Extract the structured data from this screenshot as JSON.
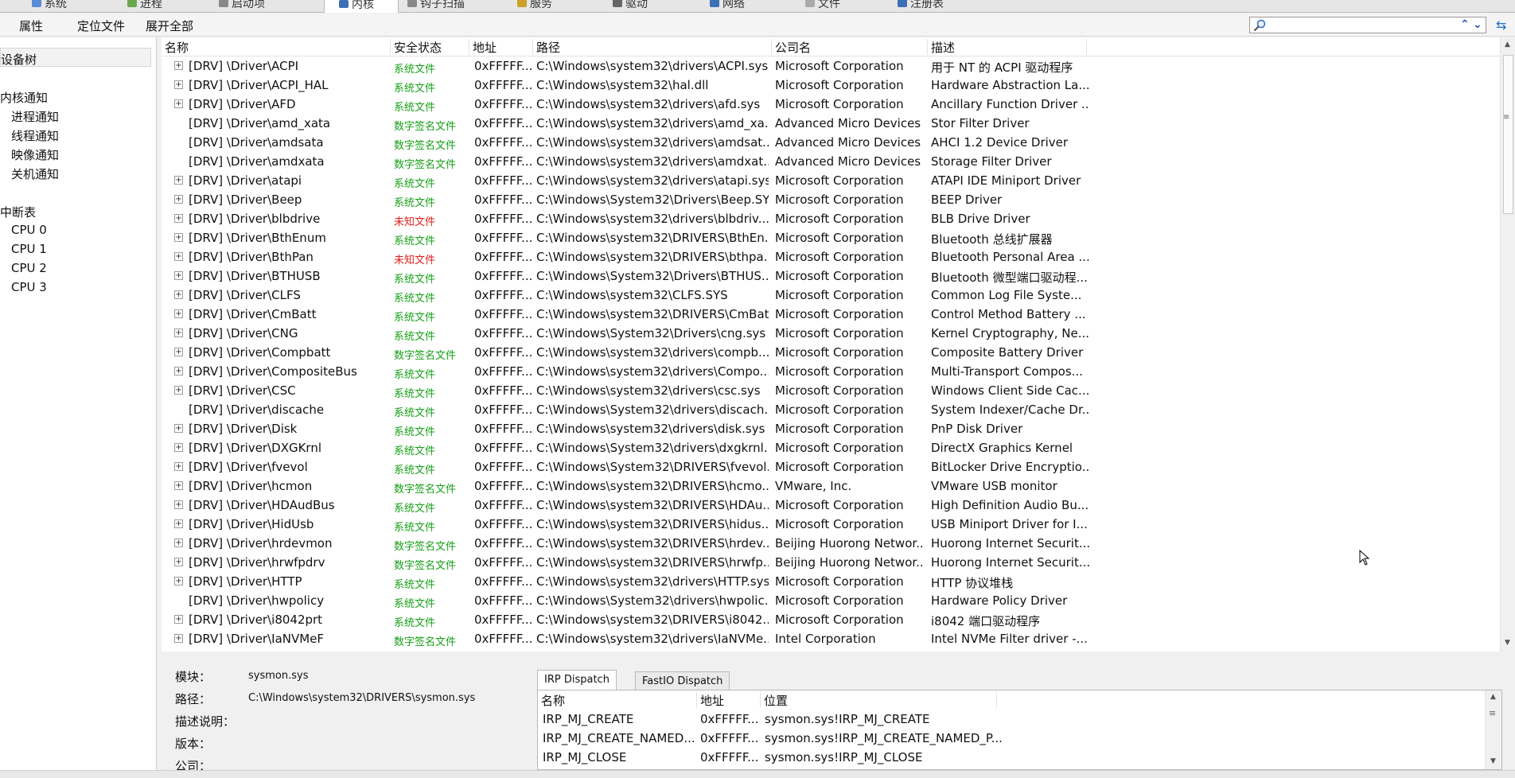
{
  "tabs": [
    {
      "label": "系统",
      "icon": "system-icon",
      "active": false
    },
    {
      "label": "进程",
      "icon": "process-icon",
      "active": false
    },
    {
      "label": "启动项",
      "icon": "startup-icon",
      "active": false
    },
    {
      "label": "内核",
      "icon": "kernel-icon",
      "active": true
    },
    {
      "label": "钩子扫描",
      "icon": "hook-icon",
      "active": false
    },
    {
      "label": "服务",
      "icon": "service-icon",
      "active": false
    },
    {
      "label": "驱动",
      "icon": "driver-icon",
      "active": false
    },
    {
      "label": "网络",
      "icon": "network-icon",
      "active": false
    },
    {
      "label": "文件",
      "icon": "file-icon",
      "active": false
    },
    {
      "label": "注册表",
      "icon": "registry-icon",
      "active": false
    }
  ],
  "toolbar": {
    "properties": "属性",
    "locate_file": "定位文件",
    "expand_all": "展开全部",
    "search_value": ""
  },
  "tree": {
    "header": "设备树",
    "kernel_notify": "内核通知",
    "process_notify": "进程通知",
    "thread_notify": "线程通知",
    "image_notify": "映像通知",
    "shutdown_notify": "关机通知",
    "interrupt_table": "中断表",
    "cpus": [
      "CPU 0",
      "CPU 1",
      "CPU 2",
      "CPU 3"
    ]
  },
  "columns": {
    "name": "名称",
    "security": "安全状态",
    "address": "地址",
    "path": "路径",
    "company": "公司名",
    "description": "描述"
  },
  "rows": [
    {
      "exp": true,
      "name": "[DRV] \\Driver\\ACPI",
      "status": "系统文件",
      "status_kind": "sys",
      "addr": "0xFFFFF...",
      "path": "C:\\Windows\\system32\\drivers\\ACPI.sys",
      "company": "Microsoft Corporation",
      "desc": "用于 NT 的 ACPI 驱动程序"
    },
    {
      "exp": true,
      "name": "[DRV] \\Driver\\ACPI_HAL",
      "status": "系统文件",
      "status_kind": "sys",
      "addr": "0xFFFFF...",
      "path": "C:\\Windows\\system32\\hal.dll",
      "company": "Microsoft Corporation",
      "desc": "Hardware Abstraction La..."
    },
    {
      "exp": true,
      "name": "[DRV] \\Driver\\AFD",
      "status": "系统文件",
      "status_kind": "sys",
      "addr": "0xFFFFF...",
      "path": "C:\\Windows\\system32\\drivers\\afd.sys",
      "company": "Microsoft Corporation",
      "desc": "Ancillary Function Driver ..."
    },
    {
      "exp": false,
      "name": "[DRV] \\Driver\\amd_xata",
      "status": "数字签名文件",
      "status_kind": "signed",
      "addr": "0xFFFFF...",
      "path": "C:\\Windows\\system32\\drivers\\amd_xa...",
      "company": "Advanced Micro Devices",
      "desc": "Stor Filter Driver"
    },
    {
      "exp": false,
      "name": "[DRV] \\Driver\\amdsata",
      "status": "数字签名文件",
      "status_kind": "signed",
      "addr": "0xFFFFF...",
      "path": "C:\\Windows\\system32\\drivers\\amdsat...",
      "company": "Advanced Micro Devices",
      "desc": "AHCI 1.2 Device Driver"
    },
    {
      "exp": false,
      "name": "[DRV] \\Driver\\amdxata",
      "status": "数字签名文件",
      "status_kind": "signed",
      "addr": "0xFFFFF...",
      "path": "C:\\Windows\\system32\\drivers\\amdxat...",
      "company": "Advanced Micro Devices",
      "desc": "Storage Filter Driver"
    },
    {
      "exp": true,
      "name": "[DRV] \\Driver\\atapi",
      "status": "系统文件",
      "status_kind": "sys",
      "addr": "0xFFFFF...",
      "path": "C:\\Windows\\system32\\drivers\\atapi.sys",
      "company": "Microsoft Corporation",
      "desc": "ATAPI IDE Miniport Driver"
    },
    {
      "exp": true,
      "name": "[DRV] \\Driver\\Beep",
      "status": "系统文件",
      "status_kind": "sys",
      "addr": "0xFFFFF...",
      "path": "C:\\Windows\\System32\\Drivers\\Beep.SYS",
      "company": "Microsoft Corporation",
      "desc": "BEEP Driver"
    },
    {
      "exp": true,
      "name": "[DRV] \\Driver\\blbdrive",
      "status": "未知文件",
      "status_kind": "unknown",
      "addr": "0xFFFFF...",
      "path": "C:\\Windows\\system32\\drivers\\blbdriv...",
      "company": "Microsoft Corporation",
      "desc": "BLB Drive Driver"
    },
    {
      "exp": true,
      "name": "[DRV] \\Driver\\BthEnum",
      "status": "系统文件",
      "status_kind": "sys",
      "addr": "0xFFFFF...",
      "path": "C:\\Windows\\system32\\DRIVERS\\BthEn...",
      "company": "Microsoft Corporation",
      "desc": "Bluetooth 总线扩展器"
    },
    {
      "exp": true,
      "name": "[DRV] \\Driver\\BthPan",
      "status": "未知文件",
      "status_kind": "unknown",
      "addr": "0xFFFFF...",
      "path": "C:\\Windows\\system32\\DRIVERS\\bthpa...",
      "company": "Microsoft Corporation",
      "desc": "Bluetooth Personal Area ..."
    },
    {
      "exp": true,
      "name": "[DRV] \\Driver\\BTHUSB",
      "status": "系统文件",
      "status_kind": "sys",
      "addr": "0xFFFFF...",
      "path": "C:\\Windows\\System32\\Drivers\\BTHUS...",
      "company": "Microsoft Corporation",
      "desc": "Bluetooth 微型端口驱动程..."
    },
    {
      "exp": true,
      "name": "[DRV] \\Driver\\CLFS",
      "status": "系统文件",
      "status_kind": "sys",
      "addr": "0xFFFFF...",
      "path": "C:\\Windows\\system32\\CLFS.SYS",
      "company": "Microsoft Corporation",
      "desc": "Common Log File Syste..."
    },
    {
      "exp": true,
      "name": "[DRV] \\Driver\\CmBatt",
      "status": "系统文件",
      "status_kind": "sys",
      "addr": "0xFFFFF...",
      "path": "C:\\Windows\\system32\\DRIVERS\\CmBat...",
      "company": "Microsoft Corporation",
      "desc": "Control Method Battery ..."
    },
    {
      "exp": true,
      "name": "[DRV] \\Driver\\CNG",
      "status": "系统文件",
      "status_kind": "sys",
      "addr": "0xFFFFF...",
      "path": "C:\\Windows\\System32\\Drivers\\cng.sys",
      "company": "Microsoft Corporation",
      "desc": "Kernel Cryptography, Ne..."
    },
    {
      "exp": true,
      "name": "[DRV] \\Driver\\Compbatt",
      "status": "数字签名文件",
      "status_kind": "signed",
      "addr": "0xFFFFF...",
      "path": "C:\\Windows\\system32\\drivers\\compb...",
      "company": "Microsoft Corporation",
      "desc": "Composite Battery Driver"
    },
    {
      "exp": true,
      "name": "[DRV] \\Driver\\CompositeBus",
      "status": "系统文件",
      "status_kind": "sys",
      "addr": "0xFFFFF...",
      "path": "C:\\Windows\\system32\\drivers\\Compo...",
      "company": "Microsoft Corporation",
      "desc": "Multi-Transport Compos..."
    },
    {
      "exp": true,
      "name": "[DRV] \\Driver\\CSC",
      "status": "系统文件",
      "status_kind": "sys",
      "addr": "0xFFFFF...",
      "path": "C:\\Windows\\system32\\drivers\\csc.sys",
      "company": "Microsoft Corporation",
      "desc": "Windows Client Side Cac..."
    },
    {
      "exp": false,
      "name": "[DRV] \\Driver\\discache",
      "status": "系统文件",
      "status_kind": "sys",
      "addr": "0xFFFFF...",
      "path": "C:\\Windows\\System32\\drivers\\discach...",
      "company": "Microsoft Corporation",
      "desc": "System Indexer/Cache Dr..."
    },
    {
      "exp": true,
      "name": "[DRV] \\Driver\\Disk",
      "status": "系统文件",
      "status_kind": "sys",
      "addr": "0xFFFFF...",
      "path": "C:\\Windows\\system32\\drivers\\disk.sys",
      "company": "Microsoft Corporation",
      "desc": "PnP Disk Driver"
    },
    {
      "exp": true,
      "name": "[DRV] \\Driver\\DXGKrnl",
      "status": "系统文件",
      "status_kind": "sys",
      "addr": "0xFFFFF...",
      "path": "C:\\Windows\\System32\\drivers\\dxgkrnl...",
      "company": "Microsoft Corporation",
      "desc": "DirectX Graphics Kernel"
    },
    {
      "exp": true,
      "name": "[DRV] \\Driver\\fvevol",
      "status": "系统文件",
      "status_kind": "sys",
      "addr": "0xFFFFF...",
      "path": "C:\\Windows\\System32\\DRIVERS\\fvevol...",
      "company": "Microsoft Corporation",
      "desc": "BitLocker Drive Encryptio..."
    },
    {
      "exp": true,
      "name": "[DRV] \\Driver\\hcmon",
      "status": "数字签名文件",
      "status_kind": "signed",
      "addr": "0xFFFFF...",
      "path": "C:\\Windows\\system32\\DRIVERS\\hcmo...",
      "company": "VMware, Inc.",
      "desc": "VMware USB monitor"
    },
    {
      "exp": true,
      "name": "[DRV] \\Driver\\HDAudBus",
      "status": "系统文件",
      "status_kind": "sys",
      "addr": "0xFFFFF...",
      "path": "C:\\Windows\\system32\\DRIVERS\\HDAu...",
      "company": "Microsoft Corporation",
      "desc": "High Definition Audio Bu..."
    },
    {
      "exp": true,
      "name": "[DRV] \\Driver\\HidUsb",
      "status": "系统文件",
      "status_kind": "sys",
      "addr": "0xFFFFF...",
      "path": "C:\\Windows\\system32\\DRIVERS\\hidus...",
      "company": "Microsoft Corporation",
      "desc": "USB Miniport Driver for I..."
    },
    {
      "exp": true,
      "name": "[DRV] \\Driver\\hrdevmon",
      "status": "数字签名文件",
      "status_kind": "signed",
      "addr": "0xFFFFF...",
      "path": "C:\\Windows\\system32\\DRIVERS\\hrdev...",
      "company": "Beijing Huorong Networ...",
      "desc": "Huorong Internet Securit..."
    },
    {
      "exp": true,
      "name": "[DRV] \\Driver\\hrwfpdrv",
      "status": "数字签名文件",
      "status_kind": "signed",
      "addr": "0xFFFFF...",
      "path": "C:\\Windows\\system32\\DRIVERS\\hrwfp...",
      "company": "Beijing Huorong Networ...",
      "desc": "Huorong Internet Securit..."
    },
    {
      "exp": true,
      "name": "[DRV] \\Driver\\HTTP",
      "status": "系统文件",
      "status_kind": "sys",
      "addr": "0xFFFFF...",
      "path": "C:\\Windows\\system32\\drivers\\HTTP.sys",
      "company": "Microsoft Corporation",
      "desc": "HTTP 协议堆栈"
    },
    {
      "exp": false,
      "name": "[DRV] \\Driver\\hwpolicy",
      "status": "系统文件",
      "status_kind": "sys",
      "addr": "0xFFFFF...",
      "path": "C:\\Windows\\System32\\drivers\\hwpolic...",
      "company": "Microsoft Corporation",
      "desc": "Hardware Policy Driver"
    },
    {
      "exp": true,
      "name": "[DRV] \\Driver\\i8042prt",
      "status": "系统文件",
      "status_kind": "sys",
      "addr": "0xFFFFF...",
      "path": "C:\\Windows\\system32\\DRIVERS\\i8042...",
      "company": "Microsoft Corporation",
      "desc": "i8042 端口驱动程序"
    },
    {
      "exp": true,
      "name": "[DRV] \\Driver\\IaNVMeF",
      "status": "数字签名文件",
      "status_kind": "signed",
      "addr": "0xFFFFF...",
      "path": "C:\\Windows\\system32\\drivers\\IaNVMe...",
      "company": "Intel Corporation",
      "desc": "Intel NVMe Filter driver -..."
    }
  ],
  "detail": {
    "module_label": "模块：",
    "module_value": "sysmon.sys",
    "path_label": "路径：",
    "path_value": "C:\\Windows\\system32\\DRIVERS\\sysmon.sys",
    "desc_label": "描述说明：",
    "version_label": "版本：",
    "company_label": "公司："
  },
  "dispatch": {
    "tabs": [
      "IRP Dispatch",
      "FastIO Dispatch"
    ],
    "columns": {
      "name": "名称",
      "address": "地址",
      "location": "位置"
    },
    "rows": [
      {
        "name": "IRP_MJ_CREATE",
        "addr": "0xFFFFF...",
        "loc": "sysmon.sys!IRP_MJ_CREATE"
      },
      {
        "name": "IRP_MJ_CREATE_NAMED...",
        "addr": "0xFFFFF...",
        "loc": "sysmon.sys!IRP_MJ_CREATE_NAMED_P..."
      },
      {
        "name": "IRP_MJ_CLOSE",
        "addr": "0xFFFFF...",
        "loc": "sysmon.sys!IRP_MJ_CLOSE"
      }
    ]
  },
  "colors": {
    "system_file": "#16a016",
    "signed_file": "#16a016",
    "unknown_file": "#e0201a"
  }
}
